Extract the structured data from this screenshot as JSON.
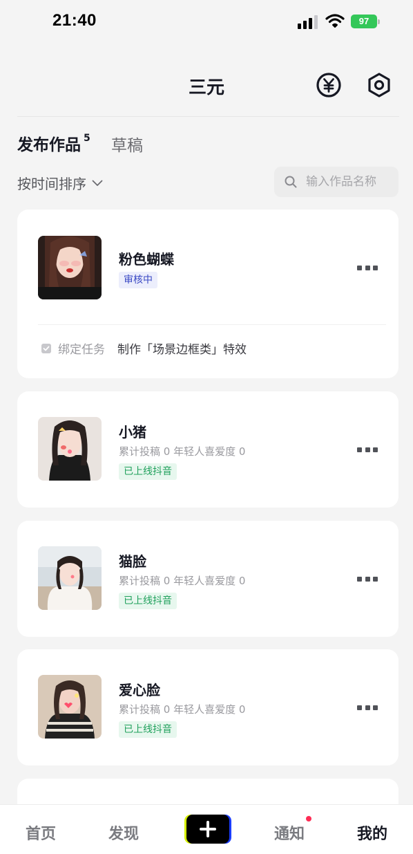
{
  "status_bar": {
    "time": "21:40",
    "battery": "97"
  },
  "header": {
    "title": "三元",
    "yen_icon": "yen-circle-icon",
    "settings_icon": "hexagon-settings-icon"
  },
  "tabs": {
    "published_label": "发布作品",
    "published_count": "5",
    "drafts_label": "草稿"
  },
  "sort": {
    "label": "按时间排序"
  },
  "search": {
    "placeholder": "输入作品名称"
  },
  "works": [
    {
      "name": "粉色蝴蝶",
      "status": "审核中",
      "task_label": "绑定任务",
      "task_value": "制作「场景边框类」特效"
    },
    {
      "name": "小猪",
      "stats": "累计投稿 0  年轻人喜爱度 0",
      "status": "已上线抖音"
    },
    {
      "name": "猫脸",
      "stats": "累计投稿 0  年轻人喜爱度 0",
      "status": "已上线抖音"
    },
    {
      "name": "爱心脸",
      "stats": "累计投稿 0  年轻人喜爱度 0",
      "status": "已上线抖音"
    }
  ],
  "tabbar": {
    "home": "首页",
    "discover": "发现",
    "notifications": "通知",
    "me": "我的"
  },
  "colors": {
    "accent_red": "#fe2c55",
    "online_green": "#1fa05b",
    "review_blue": "#3a49c4",
    "battery_green": "#34c759"
  }
}
